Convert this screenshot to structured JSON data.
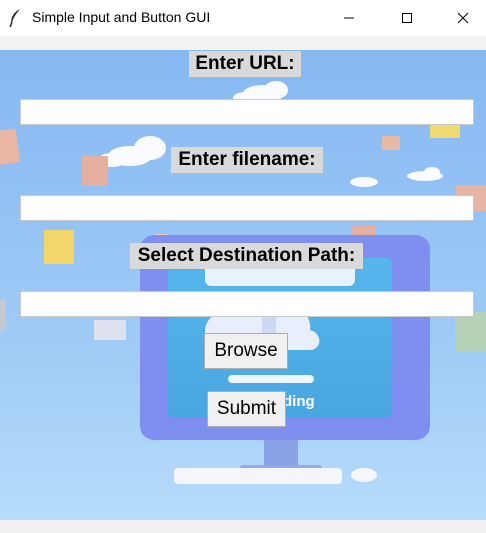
{
  "window": {
    "title": "Simple Input and Button GUI",
    "controls": [
      "minimize",
      "maximize",
      "close"
    ]
  },
  "form": {
    "url_label": "Enter URL:",
    "url_value": "",
    "filename_label": "Enter filename:",
    "filename_value": "",
    "destination_label": "Select Destination Path:",
    "destination_value": "",
    "browse_label": "Browse",
    "submit_label": "Submit"
  },
  "background": {
    "illustration_text": "ding",
    "colors": {
      "sky": "#8ec1f4",
      "monitor": "#7b8cf0",
      "screen": "#5bb8ea",
      "folder_yellow": "#f3da6c",
      "folder_pink": "#e9b9a8"
    }
  }
}
